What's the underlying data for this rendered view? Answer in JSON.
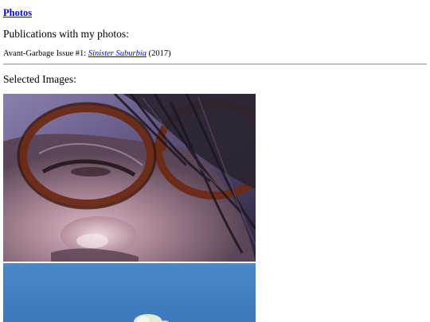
{
  "header": {
    "title_link": "Photos"
  },
  "publications": {
    "intro": "Publications with my photos:",
    "items": [
      {
        "prefix": "Avant-Garbage Issue #1: ",
        "link_text": "Sinister Suburbia",
        "suffix": " (2017)"
      }
    ]
  },
  "gallery": {
    "heading": "Selected Images:",
    "images": [
      {
        "subject": "close-up face with tortoiseshell glasses"
      },
      {
        "subject": "pale object against blue sky"
      }
    ]
  },
  "colors": {
    "link": "#0000ee",
    "rule": "#9a9a9a",
    "sky": "#3f7fc1"
  }
}
